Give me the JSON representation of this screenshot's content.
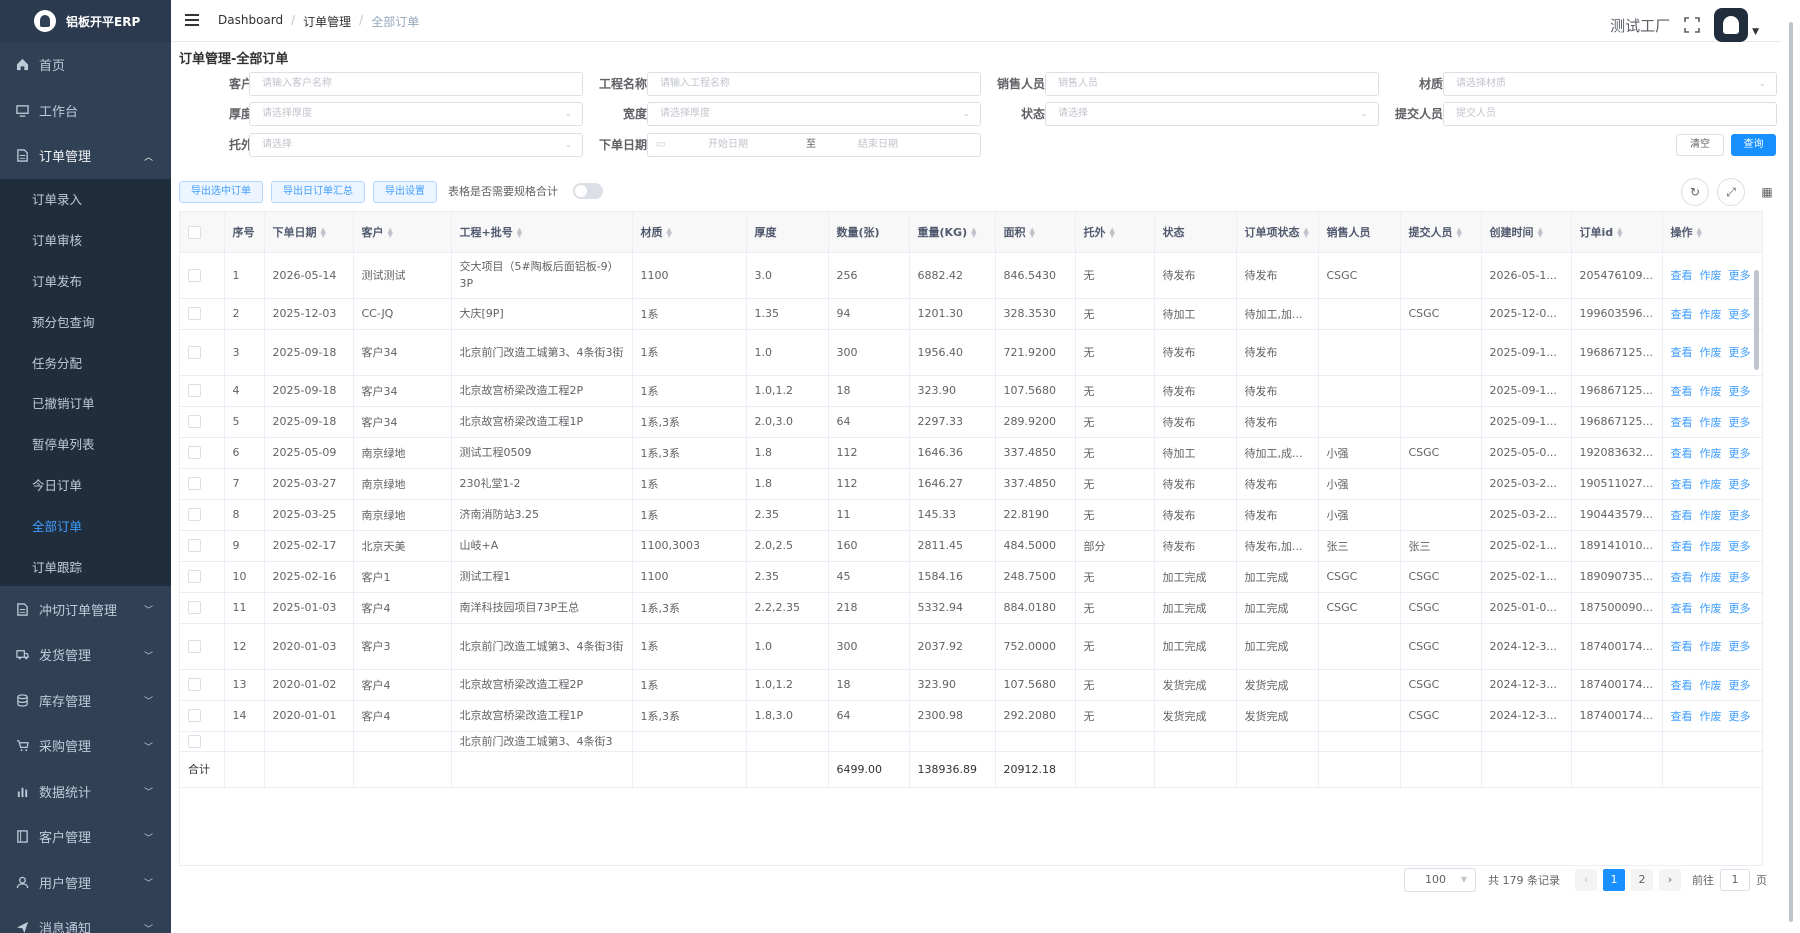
{
  "app": {
    "logo_text": "铝板开平ERP"
  },
  "sidebar": {
    "items": [
      {
        "label": "首页",
        "icon": "home-icon"
      },
      {
        "label": "工作台",
        "icon": "monitor-icon"
      },
      {
        "label": "订单管理",
        "icon": "document-icon",
        "open": true,
        "children": [
          "订单录入",
          "订单审核",
          "订单发布",
          "预分包查询",
          "任务分配",
          "已撤销订单",
          "暂停单列表",
          "今日订单",
          "全部订单",
          "订单跟踪"
        ],
        "active_child": "全部订单"
      },
      {
        "label": "冲切订单管理",
        "icon": "document-icon"
      },
      {
        "label": "发货管理",
        "icon": "truck-icon"
      },
      {
        "label": "库存管理",
        "icon": "database-icon"
      },
      {
        "label": "采购管理",
        "icon": "cart-icon"
      },
      {
        "label": "数据统计",
        "icon": "chart-icon"
      },
      {
        "label": "客户管理",
        "icon": "book-icon"
      },
      {
        "label": "用户管理",
        "icon": "user-icon"
      },
      {
        "label": "消息通知",
        "icon": "send-icon"
      }
    ]
  },
  "navbar": {
    "breadcrumb": [
      "Dashboard",
      "订单管理",
      "全部订单"
    ],
    "factory": "测试工厂"
  },
  "page": {
    "title": "订单管理-全部订单"
  },
  "filters": {
    "customer": {
      "label": "客户",
      "placeholder": "请输入客户名称"
    },
    "project": {
      "label": "工程名称",
      "placeholder": "请输入工程名称"
    },
    "sales": {
      "label": "销售人员",
      "placeholder": "销售人员"
    },
    "material": {
      "label": "材质",
      "placeholder": "请选择材质"
    },
    "thickness": {
      "label": "厚度",
      "placeholder": "请选择厚度"
    },
    "width": {
      "label": "宽度",
      "placeholder": "请选择厚度"
    },
    "status": {
      "label": "状态",
      "placeholder": "请选择"
    },
    "submitter": {
      "label": "提交人员",
      "placeholder": "提交人员"
    },
    "outsource": {
      "label": "托外",
      "placeholder": "请选择"
    },
    "date": {
      "label": "下单日期",
      "start": "开始日期",
      "to": "至",
      "end": "结束日期"
    },
    "clear_label": "清空",
    "query_label": "查询"
  },
  "toolbar": {
    "export_selected": "导出选中订单",
    "export_daily": "导出日订单汇总",
    "export_settings": "导出设置",
    "switch_label": "表格是否需要规格合计"
  },
  "table": {
    "columns": [
      "序号",
      "下单日期",
      "客户",
      "工程+批号",
      "材质",
      "厚度",
      "数量(张)",
      "重量(KG)",
      "面积",
      "托外",
      "状态",
      "订单项状态",
      "销售人员",
      "提交人员",
      "创建时间",
      "订单id",
      "操作"
    ],
    "rows": [
      {
        "no": "1",
        "date": "2026-05-14",
        "customer": "测试测试",
        "project": "交大项目（5#陶板后面铝板-9）3P",
        "material": "1100",
        "thickness": "3.0",
        "qty": "256",
        "weight": "6882.42",
        "area": "846.5430",
        "outsource": "无",
        "status": "待发布",
        "item_status": "待发布",
        "sales": "CSGC",
        "submitter": "",
        "created": "2026-05-1...",
        "id": "205476109..."
      },
      {
        "no": "2",
        "date": "2025-12-03",
        "customer": "CC-JQ",
        "project": "大庆[9P]",
        "material": "1系",
        "thickness": "1.35",
        "qty": "94",
        "weight": "1201.30",
        "area": "328.3530",
        "outsource": "无",
        "status": "待加工",
        "item_status": "待加工,加...",
        "sales": "",
        "submitter": "CSGC",
        "created": "2025-12-0...",
        "id": "199603596..."
      },
      {
        "no": "3",
        "date": "2025-09-18",
        "customer": "客户34",
        "project": "北京前门改造工城第3、4条街3街",
        "material": "1系",
        "thickness": "1.0",
        "qty": "300",
        "weight": "1956.40",
        "area": "721.9200",
        "outsource": "无",
        "status": "待发布",
        "item_status": "待发布",
        "sales": "",
        "submitter": "",
        "created": "2025-09-1...",
        "id": "196867125..."
      },
      {
        "no": "4",
        "date": "2025-09-18",
        "customer": "客户34",
        "project": "北京故宫桥梁改造工程2P",
        "material": "1系",
        "thickness": "1.0,1.2",
        "qty": "18",
        "weight": "323.90",
        "area": "107.5680",
        "outsource": "无",
        "status": "待发布",
        "item_status": "待发布",
        "sales": "",
        "submitter": "",
        "created": "2025-09-1...",
        "id": "196867125..."
      },
      {
        "no": "5",
        "date": "2025-09-18",
        "customer": "客户34",
        "project": "北京故宫桥梁改造工程1P",
        "material": "1系,3系",
        "thickness": "2.0,3.0",
        "qty": "64",
        "weight": "2297.33",
        "area": "289.9200",
        "outsource": "无",
        "status": "待发布",
        "item_status": "待发布",
        "sales": "",
        "submitter": "",
        "created": "2025-09-1...",
        "id": "196867125..."
      },
      {
        "no": "6",
        "date": "2025-05-09",
        "customer": "南京绿地",
        "project": "测试工程0509",
        "material": "1系,3系",
        "thickness": "1.8",
        "qty": "112",
        "weight": "1646.36",
        "area": "337.4850",
        "outsource": "无",
        "status": "待加工",
        "item_status": "待加工,成...",
        "sales": "小强",
        "submitter": "CSGC",
        "created": "2025-05-0...",
        "id": "192083632..."
      },
      {
        "no": "7",
        "date": "2025-03-27",
        "customer": "南京绿地",
        "project": "230礼堂1-2",
        "material": "1系",
        "thickness": "1.8",
        "qty": "112",
        "weight": "1646.27",
        "area": "337.4850",
        "outsource": "无",
        "status": "待发布",
        "item_status": "待发布",
        "sales": "小强",
        "submitter": "",
        "created": "2025-03-2...",
        "id": "190511027..."
      },
      {
        "no": "8",
        "date": "2025-03-25",
        "customer": "南京绿地",
        "project": "济南消防站3.25",
        "material": "1系",
        "thickness": "2.35",
        "qty": "11",
        "weight": "145.33",
        "area": "22.8190",
        "outsource": "无",
        "status": "待发布",
        "item_status": "待发布",
        "sales": "小强",
        "submitter": "",
        "created": "2025-03-2...",
        "id": "190443579..."
      },
      {
        "no": "9",
        "date": "2025-02-17",
        "customer": "北京天美",
        "project": "山岐+A",
        "material": "1100,3003",
        "thickness": "2.0,2.5",
        "qty": "160",
        "weight": "2811.45",
        "area": "484.5000",
        "outsource": "部分",
        "status": "待发布",
        "item_status": "待发布,加...",
        "sales": "张三",
        "submitter": "张三",
        "created": "2025-02-1...",
        "id": "189141010..."
      },
      {
        "no": "10",
        "date": "2025-02-16",
        "customer": "客户1",
        "project": "测试工程1",
        "material": "1100",
        "thickness": "2.35",
        "qty": "45",
        "weight": "1584.16",
        "area": "248.7500",
        "outsource": "无",
        "status": "加工完成",
        "item_status": "加工完成",
        "sales": "CSGC",
        "submitter": "CSGC",
        "created": "2025-02-1...",
        "id": "189090735..."
      },
      {
        "no": "11",
        "date": "2025-01-03",
        "customer": "客户4",
        "project": "南洋科技园项目73P王总",
        "material": "1系,3系",
        "thickness": "2.2,2.35",
        "qty": "218",
        "weight": "5332.94",
        "area": "884.0180",
        "outsource": "无",
        "status": "加工完成",
        "item_status": "加工完成",
        "sales": "CSGC",
        "submitter": "CSGC",
        "created": "2025-01-0...",
        "id": "187500090..."
      },
      {
        "no": "12",
        "date": "2020-01-03",
        "customer": "客户3",
        "project": "北京前门改造工城第3、4条街3街",
        "material": "1系",
        "thickness": "1.0",
        "qty": "300",
        "weight": "2037.92",
        "area": "752.0000",
        "outsource": "无",
        "status": "加工完成",
        "item_status": "加工完成",
        "sales": "",
        "submitter": "CSGC",
        "created": "2024-12-3...",
        "id": "187400174..."
      },
      {
        "no": "13",
        "date": "2020-01-02",
        "customer": "客户4",
        "project": "北京故宫桥梁改造工程2P",
        "material": "1系",
        "thickness": "1.0,1.2",
        "qty": "18",
        "weight": "323.90",
        "area": "107.5680",
        "outsource": "无",
        "status": "发货完成",
        "item_status": "发货完成",
        "sales": "",
        "submitter": "CSGC",
        "created": "2024-12-3...",
        "id": "187400174..."
      },
      {
        "no": "14",
        "date": "2020-01-01",
        "customer": "客户4",
        "project": "北京故宫桥梁改造工程1P",
        "material": "1系,3系",
        "thickness": "1.8,3.0",
        "qty": "64",
        "weight": "2300.98",
        "area": "292.2080",
        "outsource": "无",
        "status": "发货完成",
        "item_status": "发货完成",
        "sales": "",
        "submitter": "CSGC",
        "created": "2024-12-3...",
        "id": "187400174..."
      },
      {
        "no": "",
        "date": "",
        "customer": "",
        "project": "北京前门改造工城第3、4条街3",
        "material": "",
        "thickness": "",
        "qty": "",
        "weight": "",
        "area": "",
        "outsource": "",
        "status": "",
        "item_status": "",
        "sales": "",
        "submitter": "",
        "created": "",
        "id": ""
      }
    ],
    "actions": [
      "查看",
      "作废",
      "更多"
    ],
    "summary": {
      "label": "合计",
      "qty": "6499.00",
      "weight": "138936.89",
      "area": "20912.18"
    }
  },
  "pagination": {
    "page_size": "100",
    "total_text": "共 179 条记录",
    "pages": [
      "1",
      "2"
    ],
    "current": "1",
    "goto_label": "前往",
    "goto_value": "1",
    "page_suffix": "页"
  }
}
